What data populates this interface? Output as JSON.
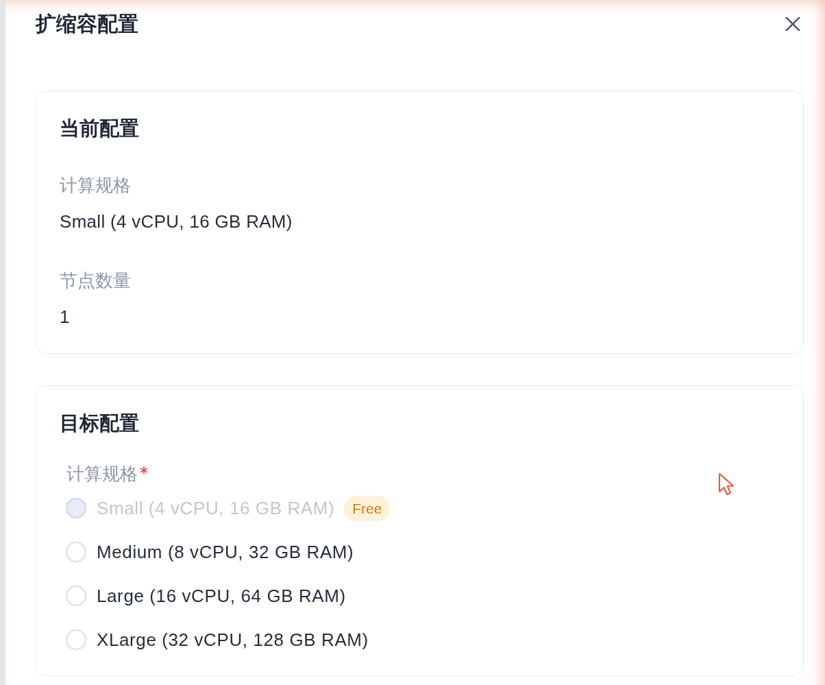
{
  "drawer": {
    "title": "扩缩容配置"
  },
  "current_config": {
    "title": "当前配置",
    "fields": [
      {
        "label": "计算规格",
        "value": "Small (4 vCPU, 16 GB RAM)"
      },
      {
        "label": "节点数量",
        "value": "1"
      }
    ]
  },
  "target_config": {
    "title": "目标配置",
    "compute_spec": {
      "label": "计算规格",
      "required": true,
      "options": [
        {
          "label": "Small (4 vCPU, 16 GB RAM)",
          "selected": false,
          "disabled": true,
          "badge": "Free"
        },
        {
          "label": "Medium (8 vCPU, 32 GB RAM)",
          "selected": false,
          "disabled": false
        },
        {
          "label": "Large (16 vCPU, 64 GB RAM)",
          "selected": false,
          "disabled": false
        },
        {
          "label": "XLarge (32 vCPU, 128 GB RAM)",
          "selected": false,
          "disabled": false
        }
      ]
    }
  }
}
